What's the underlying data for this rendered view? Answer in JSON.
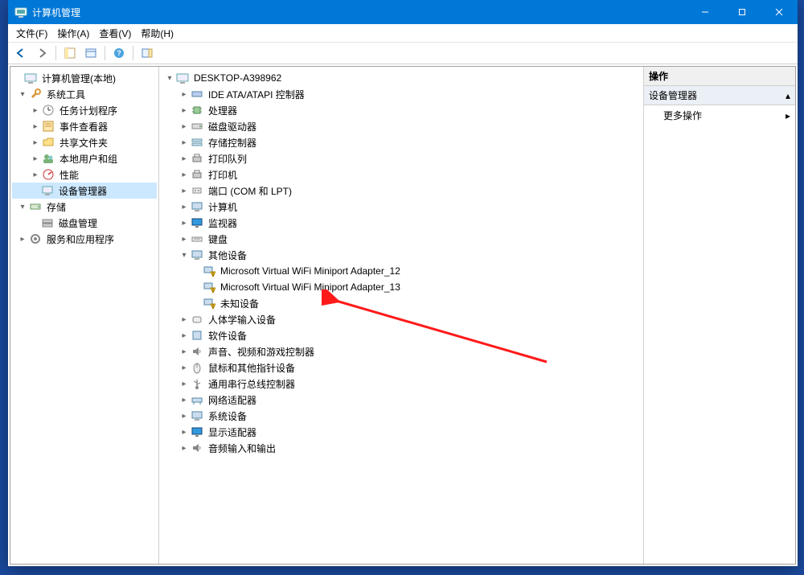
{
  "window": {
    "title": "计算机管理"
  },
  "menu": {
    "file": "文件(F)",
    "action": "操作(A)",
    "view": "查看(V)",
    "help": "帮助(H)"
  },
  "leftTree": {
    "root": "计算机管理(本地)",
    "systemTools": "系统工具",
    "taskScheduler": "任务计划程序",
    "eventViewer": "事件查看器",
    "sharedFolders": "共享文件夹",
    "localUsers": "本地用户和组",
    "performance": "性能",
    "deviceManager": "设备管理器",
    "storage": "存储",
    "diskMgmt": "磁盘管理",
    "services": "服务和应用程序"
  },
  "centerTree": {
    "computer": "DESKTOP-A398962",
    "ide": "IDE ATA/ATAPI 控制器",
    "processors": "处理器",
    "diskDrives": "磁盘驱动器",
    "storageControllers": "存储控制器",
    "printQueues": "打印队列",
    "printers": "打印机",
    "ports": "端口 (COM 和 LPT)",
    "computers": "计算机",
    "monitors": "监视器",
    "keyboards": "键盘",
    "otherDevices": "其他设备",
    "wifi12": "Microsoft Virtual WiFi Miniport Adapter_12",
    "wifi13": "Microsoft Virtual WiFi Miniport Adapter_13",
    "unknown": "未知设备",
    "hid": "人体学输入设备",
    "software": "软件设备",
    "sound": "声音、视频和游戏控制器",
    "mice": "鼠标和其他指针设备",
    "usb": "通用串行总线控制器",
    "network": "网络适配器",
    "system": "系统设备",
    "display": "显示适配器",
    "audio": "音频输入和输出"
  },
  "actions": {
    "header": "操作",
    "sectionTitle": "设备管理器",
    "more": "更多操作"
  }
}
